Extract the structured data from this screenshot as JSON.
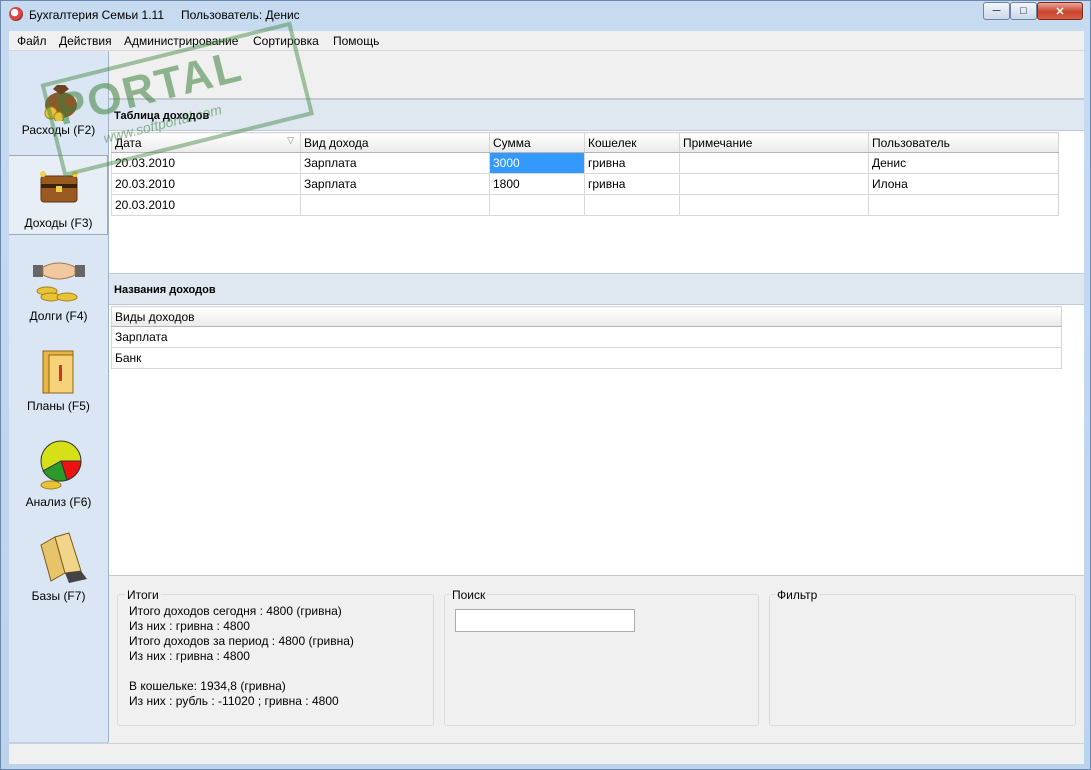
{
  "window": {
    "title": "Бухгалтерия Семьи 1.11",
    "user_label": "Пользователь: Денис",
    "controls": {
      "minimize": "minimize-icon",
      "maximize": "maximize-icon",
      "close": "close-icon"
    }
  },
  "menu": [
    "Файл",
    "Действия",
    "Администрирование",
    "Сортировка",
    "Помощь"
  ],
  "sidebar": {
    "items": [
      {
        "label": "Расходы (F2)",
        "icon": "money-bag-icon",
        "active": false
      },
      {
        "label": "Доходы (F3)",
        "icon": "treasure-chest-icon",
        "active": true
      },
      {
        "label": "Долги (F4)",
        "icon": "handshake-coins-icon",
        "active": false
      },
      {
        "label": "Планы (F5)",
        "icon": "folder-icon",
        "active": false
      },
      {
        "label": "Анализ (F6)",
        "icon": "pie-chart-icon",
        "active": false
      },
      {
        "label": "Базы (F7)",
        "icon": "books-icon",
        "active": false
      }
    ]
  },
  "income_table": {
    "section_title": "Таблица доходов",
    "columns": [
      "Дата",
      "Вид дохода",
      "Сумма",
      "Кошелек",
      "Примечание",
      "Пользователь"
    ],
    "rows": [
      [
        "20.03.2010",
        "Зарплата",
        "3000",
        "гривна",
        "",
        "Денис"
      ],
      [
        "20.03.2010",
        "Зарплата",
        "1800",
        "гривна",
        "",
        "Илона"
      ],
      [
        "20.03.2010",
        "",
        "",
        "",
        "",
        ""
      ]
    ],
    "selected_cell": {
      "row": 0,
      "col": 2
    }
  },
  "income_names": {
    "section_title": "Названия доходов",
    "column": "Виды доходов",
    "rows": [
      "Зарплата",
      "Банк"
    ]
  },
  "totals": {
    "title": "Итоги",
    "lines": [
      "Итого доходов сегодня : 4800 (гривна)",
      "Из них : гривна : 4800",
      "Итого доходов за период : 4800 (гривна)",
      "Из них : гривна : 4800",
      "",
      "В кошельке: 1934,8 (гривна)",
      "Из них : рубль : -11020 ; гривна : 4800"
    ]
  },
  "search": {
    "title": "Поиск",
    "value": ""
  },
  "filter": {
    "title": "Фильтр"
  },
  "watermark": {
    "text": "PORTAL",
    "sub": "www.softportal.com"
  },
  "colors": {
    "selection": "#3399ff",
    "section_header": "#dfe7f1",
    "sidebar": "#dae6f3"
  }
}
